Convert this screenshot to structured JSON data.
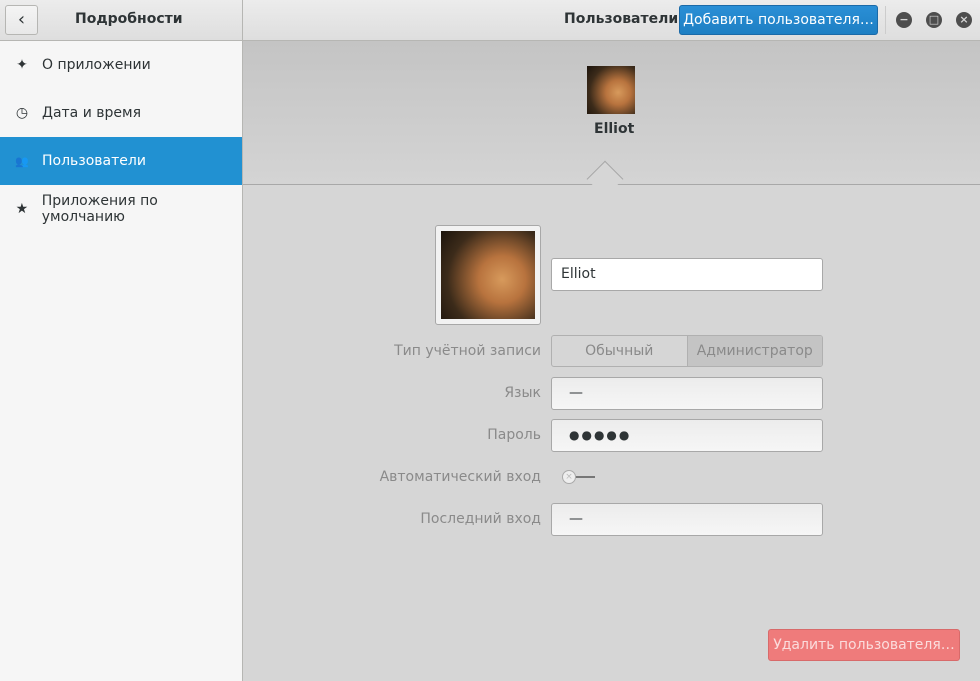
{
  "header": {
    "left_title": "Подробности",
    "right_title": "Пользователи",
    "add_user": "Добавить пользователя…"
  },
  "sidebar": {
    "items": [
      {
        "label": "О приложении",
        "icon": "sparkle-icon"
      },
      {
        "label": "Дата и время",
        "icon": "clock-icon"
      },
      {
        "label": "Пользователи",
        "icon": "users-icon",
        "selected": true
      },
      {
        "label": "Приложения по умолчанию",
        "icon": "star-icon"
      }
    ]
  },
  "user": {
    "name": "Elliot",
    "name_field": "Elliot",
    "account_type_label": "Тип учётной записи",
    "account_types": [
      "Обычный",
      "Администратор"
    ],
    "account_type_selected": "Администратор",
    "language_label": "Язык",
    "language": "—",
    "password_label": "Пароль",
    "password": "●●●●●",
    "autologin_label": "Автоматический вход",
    "autologin": false,
    "last_login_label": "Последний вход",
    "last_login": "—"
  },
  "delete_user": "Удалить пользователя…",
  "colors": {
    "accent": "#2191d2",
    "destructive": "#ef7b7b"
  }
}
